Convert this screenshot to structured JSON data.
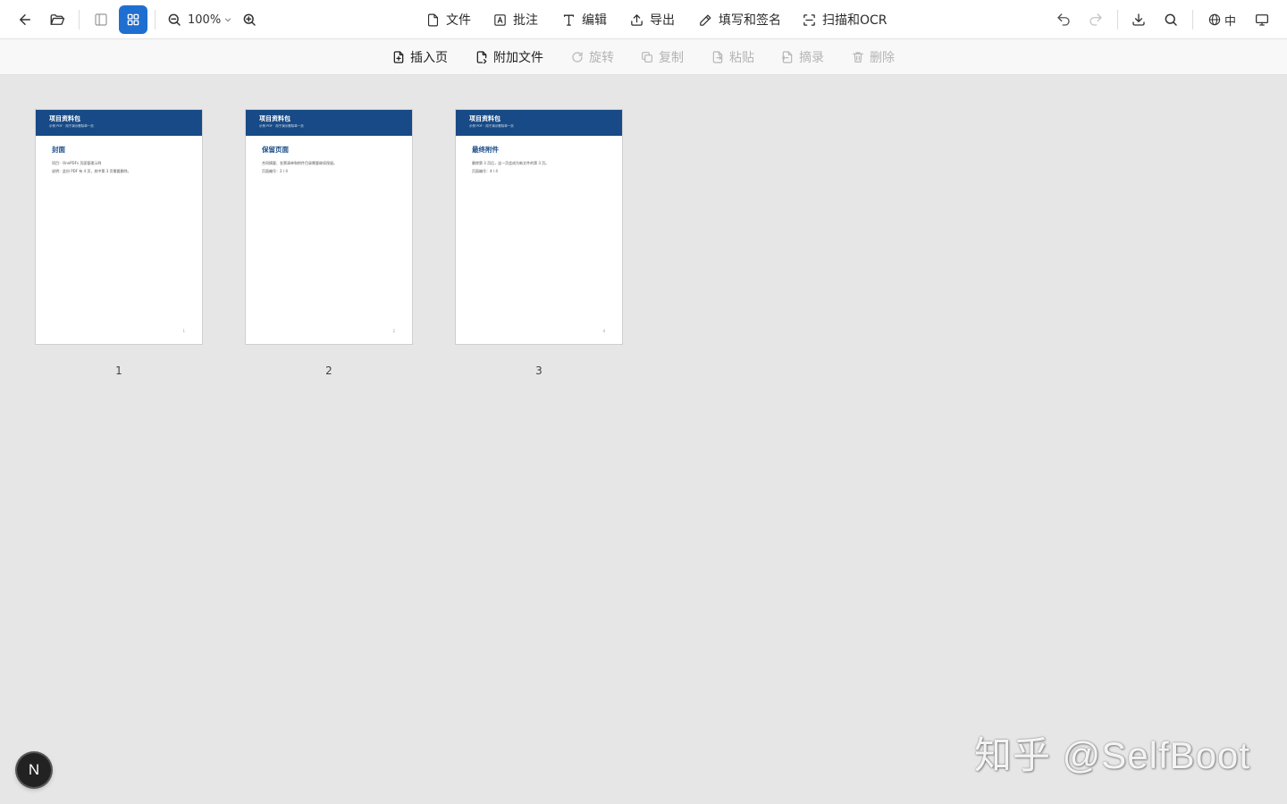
{
  "toolbar": {
    "zoom_level": "100%",
    "menu": [
      {
        "label": "文件"
      },
      {
        "label": "批注"
      },
      {
        "label": "编辑"
      },
      {
        "label": "导出"
      },
      {
        "label": "填写和签名"
      },
      {
        "label": "扫描和OCR"
      }
    ],
    "language": "中"
  },
  "subtoolbar": {
    "items": [
      {
        "label": "插入页",
        "enabled": true
      },
      {
        "label": "附加文件",
        "enabled": true
      },
      {
        "label": "旋转",
        "enabled": false
      },
      {
        "label": "复制",
        "enabled": false
      },
      {
        "label": "粘贴",
        "enabled": false
      },
      {
        "label": "摘录",
        "enabled": false
      },
      {
        "label": "删除",
        "enabled": false
      }
    ]
  },
  "pages": [
    {
      "number": "1",
      "header_title": "项目资料包",
      "header_subtitle": "示例 PDF · 用于演示删除单一页",
      "heading": "封面",
      "lines": [
        "项目：OnePDFs 页面管理示例",
        "说明：此份 PDF 有 4 页，其中第 3 页需要删除。"
      ],
      "footer_num": "1"
    },
    {
      "number": "2",
      "header_title": "项目资料包",
      "header_subtitle": "示例 PDF · 用于演示删除单一页",
      "heading": "保留页面",
      "lines": [
        "合同摘要、发票清单和附件目录需要继续保留。",
        "页面编号：2 / 4"
      ],
      "footer_num": "2"
    },
    {
      "number": "3",
      "header_title": "项目资料包",
      "header_subtitle": "示例 PDF · 用于演示删除单一页",
      "heading": "最终附件",
      "lines": [
        "删除第 3 页后，这一页会成为新文件的第 3 页。",
        "页面编号：4 / 4"
      ],
      "footer_num": "4"
    }
  ],
  "badge": "N",
  "watermark": "知乎 @SelfBoot"
}
